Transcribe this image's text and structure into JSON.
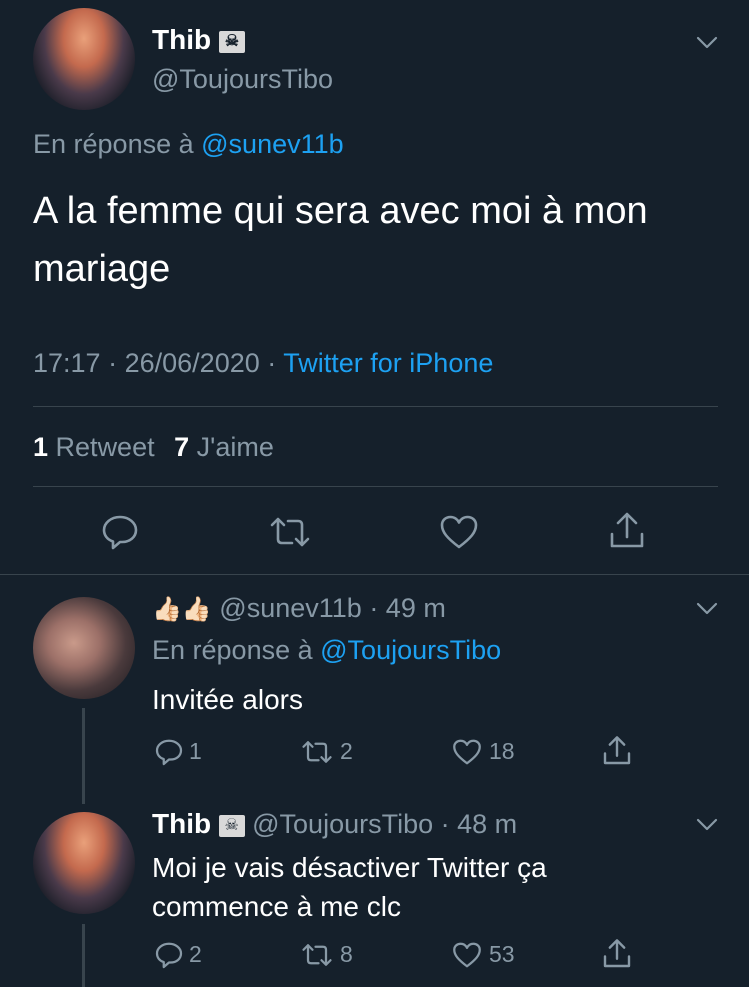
{
  "main_tweet": {
    "author_name": "Thib",
    "author_flag": "☠",
    "handle": "@ToujoursTibo",
    "reply_prefix": "En réponse à",
    "reply_to": "@sunev11b",
    "text_line1": "A la femme qui sera avec moi à mon",
    "text_line2": "mariage",
    "time": "17:17",
    "date_sep": "·",
    "date": "26/06/2020",
    "source_sep": "·",
    "source": "Twitter for iPhone",
    "retweets_count": "1",
    "retweets_label": "Retweet",
    "likes_count": "7",
    "likes_label": "J'aime"
  },
  "reply1": {
    "emoji": "👍🏻👍🏻",
    "handle": "@sunev11b",
    "time": "· 49 m",
    "reply_prefix": "En réponse à",
    "reply_to": "@ToujoursTibo",
    "text": "Invitée alors",
    "replies": "1",
    "retweets": "2",
    "likes": "18"
  },
  "reply2": {
    "author_name": "Thib",
    "author_flag": "☠",
    "handle": "@ToujoursTibo",
    "time": "· 48 m",
    "text_line1": "Moi je vais désactiver Twitter ça",
    "text_line2": "commence à me clc",
    "replies": "2",
    "retweets": "8",
    "likes": "53"
  },
  "icons": {
    "reply": "reply-icon",
    "retweet": "retweet-icon",
    "like": "heart-icon",
    "share": "share-icon",
    "more": "chevron-down-icon"
  },
  "colors": {
    "background": "#15202b",
    "text": "#ffffff",
    "secondary": "#8899a6",
    "link": "#1da1f2",
    "divider": "#38444d"
  }
}
